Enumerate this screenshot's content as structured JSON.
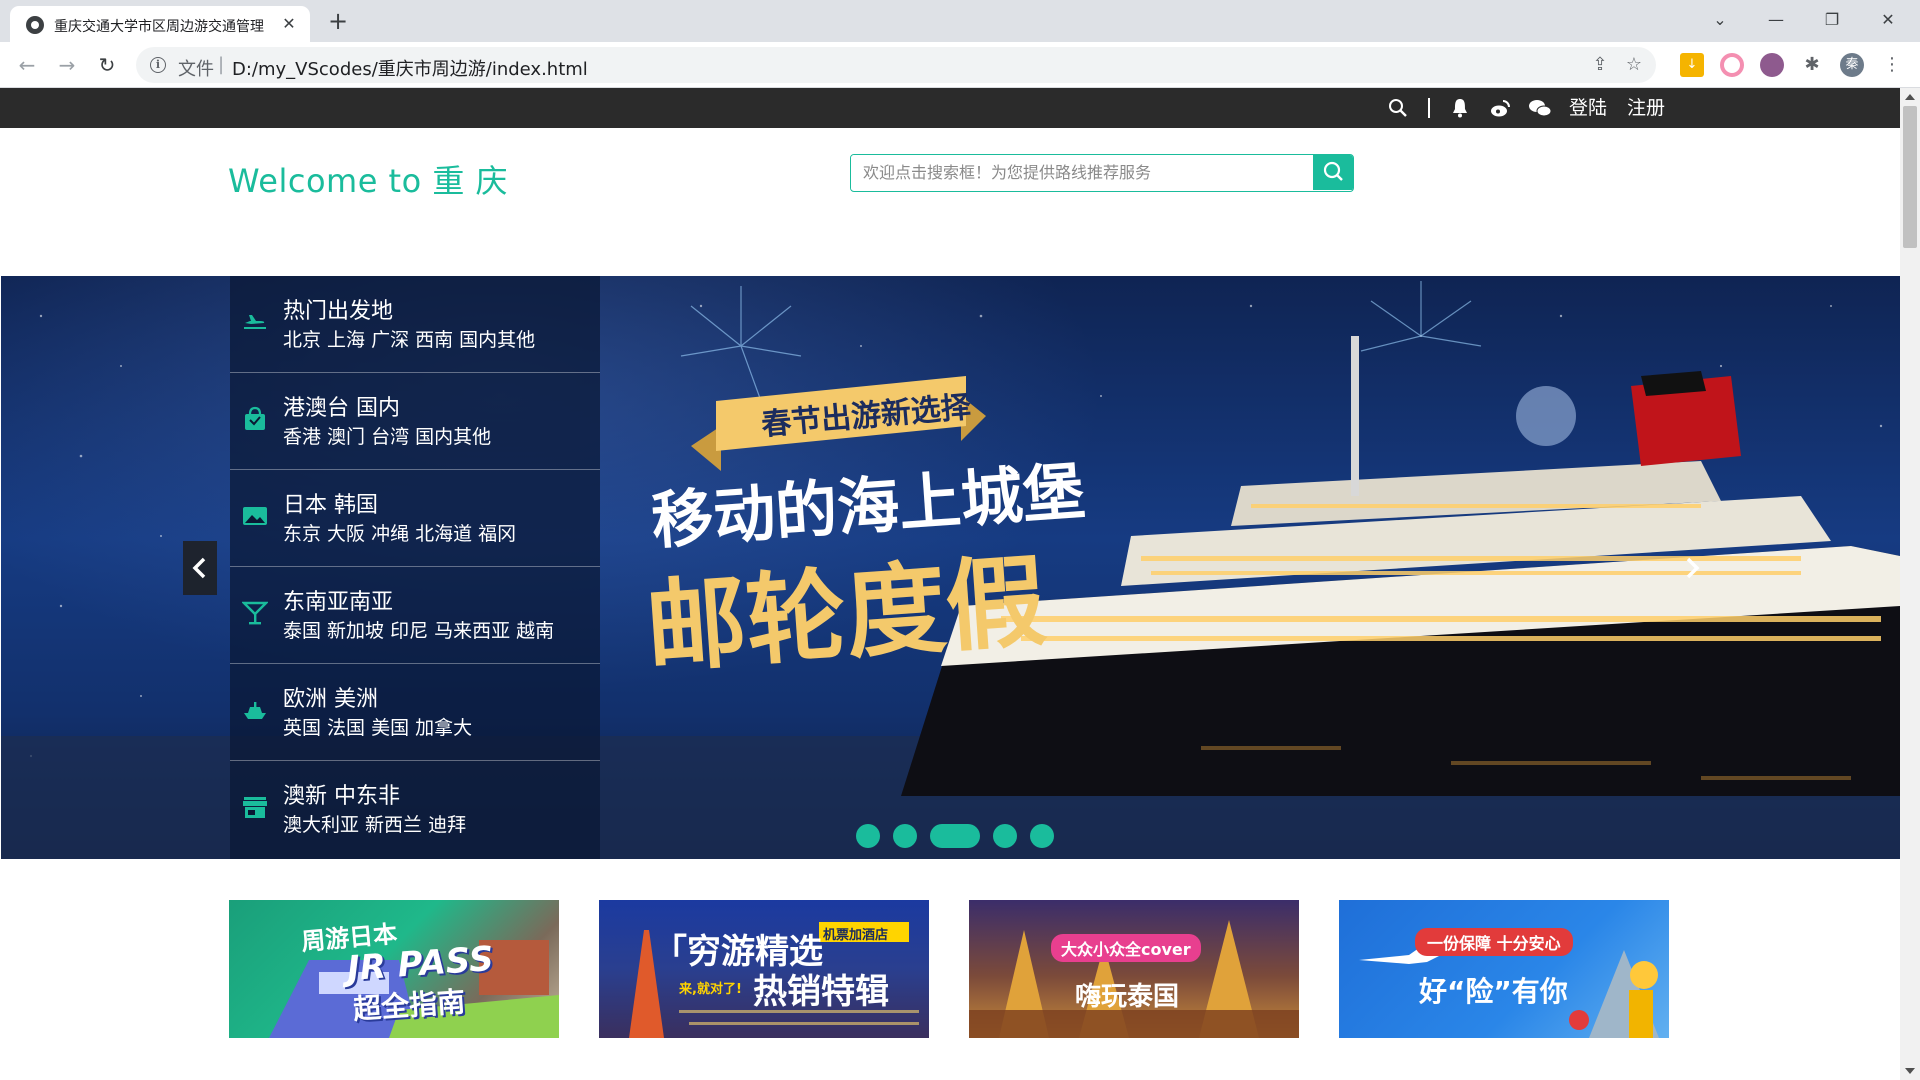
{
  "browser": {
    "tab_title": "重庆交通大学市区周边游交通管理",
    "tab_close": "✕",
    "new_tab": "+",
    "address_scheme": "文件",
    "address_separator": "|",
    "address_url": "D:/my_VScodes/重庆市周边游/index.html",
    "profile_initial": "秦"
  },
  "topbar": {
    "login": "登陆",
    "register": "注册"
  },
  "header": {
    "welcome": "Welcome to 重 庆"
  },
  "search": {
    "placeholder": "欢迎点击搜索框！为您提供路线推荐服务"
  },
  "menu": {
    "items": [
      {
        "title": "热门出发地",
        "sub": "北京 上海 广深 西南 国内其他",
        "icon": "plane-icon"
      },
      {
        "title": "港澳台 国内",
        "sub": "香港 澳门 台湾 国内其他",
        "icon": "bag-icon"
      },
      {
        "title": "日本 韩国",
        "sub": "东京 大阪 冲绳 北海道 福冈",
        "icon": "image-icon"
      },
      {
        "title": "东南亚南亚",
        "sub": "泰国 新加坡 印尼 马来西亚 越南",
        "icon": "cocktail-icon"
      },
      {
        "title": "欧洲 美洲",
        "sub": "英国 法国 美国 加拿大",
        "icon": "ship-icon"
      },
      {
        "title": "澳新 中东非",
        "sub": "澳大利亚 新西兰 迪拜",
        "icon": "store-icon"
      }
    ]
  },
  "banner": {
    "ribbon": "春节出游新选择",
    "headline": "移动的海上城堡",
    "title": "邮轮度假",
    "slide_count": 5,
    "active_slide": 3
  },
  "thumbnails": [
    {
      "line1": "周游日本",
      "line2": "JR PASS",
      "line3": "超全指南"
    },
    {
      "line1": "「穷游精选",
      "tag": "机票加酒店",
      "line2": "热销特辑",
      "line3": "来,就对了!"
    },
    {
      "tag": "大众小众全cover",
      "line1": "嗨玩泰国"
    },
    {
      "tag": "一份保障 十分安心",
      "line1": "好“险”有你"
    }
  ],
  "colors": {
    "accent": "#1abc9c",
    "topbar": "#2b2b2b",
    "banner_gold": "#f4c96b"
  }
}
